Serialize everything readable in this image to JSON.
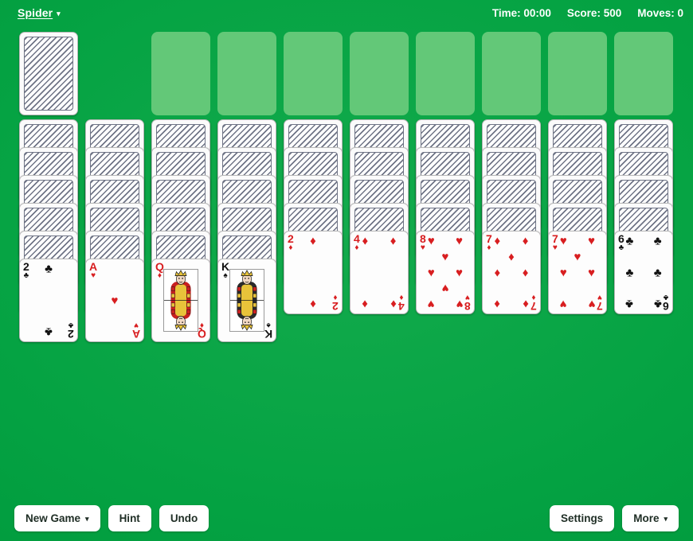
{
  "topbar": {
    "game_menu_label": "Spider",
    "game_menu_caret": "▾",
    "time_label": "Time: 00:00",
    "score_label": "Score: 500",
    "moves_label": "Moves: 0"
  },
  "colors": {
    "table_green": "#00a03e",
    "empty_slot_green": "#63c878",
    "red_suit": "#d81e20",
    "black_suit": "#111111",
    "button_bg": "#ffffff",
    "button_text": "#1e2d24"
  },
  "stock": {
    "name": "stock-pile",
    "face_down": true,
    "count_visible": 1
  },
  "foundations": [
    {
      "index": 1,
      "empty": true
    },
    {
      "index": 2,
      "empty": true
    },
    {
      "index": 3,
      "empty": true
    },
    {
      "index": 4,
      "empty": true
    },
    {
      "index": 5,
      "empty": true
    },
    {
      "index": 6,
      "empty": true
    },
    {
      "index": 7,
      "empty": true
    },
    {
      "index": 8,
      "empty": true
    }
  ],
  "tableau": {
    "columns": [
      {
        "index": 1,
        "face_down": 5,
        "face_up": [
          {
            "rank": "2",
            "suit": "clubs",
            "suit_glyph": "♣",
            "color": "black"
          }
        ]
      },
      {
        "index": 2,
        "face_down": 5,
        "face_up": [
          {
            "rank": "A",
            "suit": "hearts",
            "suit_glyph": "♥",
            "color": "red"
          }
        ]
      },
      {
        "index": 3,
        "face_down": 5,
        "face_up": [
          {
            "rank": "Q",
            "suit": "diamonds",
            "suit_glyph": "♦",
            "color": "red"
          }
        ]
      },
      {
        "index": 4,
        "face_down": 5,
        "face_up": [
          {
            "rank": "K",
            "suit": "spades",
            "suit_glyph": "♠",
            "color": "black"
          }
        ]
      },
      {
        "index": 5,
        "face_down": 4,
        "face_up": [
          {
            "rank": "2",
            "suit": "diamonds",
            "suit_glyph": "♦",
            "color": "red"
          }
        ]
      },
      {
        "index": 6,
        "face_down": 4,
        "face_up": [
          {
            "rank": "4",
            "suit": "diamonds",
            "suit_glyph": "♦",
            "color": "red"
          }
        ]
      },
      {
        "index": 7,
        "face_down": 4,
        "face_up": [
          {
            "rank": "8",
            "suit": "hearts",
            "suit_glyph": "♥",
            "color": "red"
          }
        ]
      },
      {
        "index": 8,
        "face_down": 4,
        "face_up": [
          {
            "rank": "7",
            "suit": "diamonds",
            "suit_glyph": "♦",
            "color": "red"
          }
        ]
      },
      {
        "index": 9,
        "face_down": 4,
        "face_up": [
          {
            "rank": "7",
            "suit": "hearts",
            "suit_glyph": "♥",
            "color": "red"
          }
        ]
      },
      {
        "index": 10,
        "face_down": 4,
        "face_up": [
          {
            "rank": "6",
            "suit": "clubs",
            "suit_glyph": "♣",
            "color": "black"
          }
        ]
      }
    ]
  },
  "toolbar": {
    "new_game_label": "New Game",
    "new_game_caret": "▾",
    "hint_label": "Hint",
    "undo_label": "Undo",
    "settings_label": "Settings",
    "more_label": "More",
    "more_caret": "▾"
  }
}
